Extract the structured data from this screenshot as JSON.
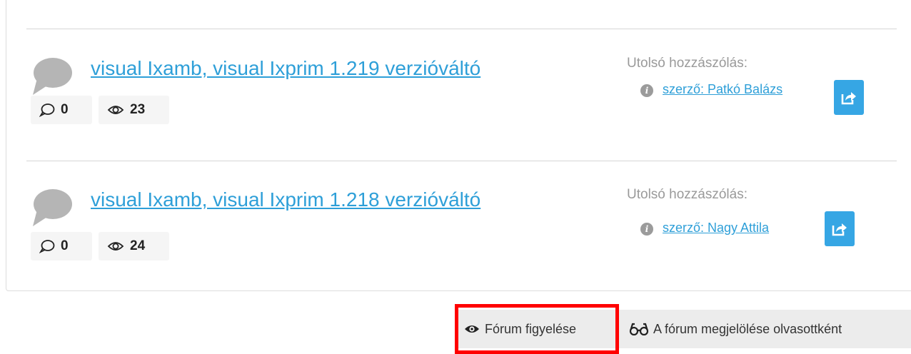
{
  "topics": [
    {
      "title": "visual Ixamb, visual Ixprim 1.219 verzióváltó",
      "replies": "0",
      "views": "23",
      "last_post_label": "Utolsó hozzászólás:",
      "author": "szerző: Patkó Balázs"
    },
    {
      "title": "visual Ixamb, visual Ixprim 1.218 verzióváltó",
      "replies": "0",
      "views": "24",
      "last_post_label": "Utolsó hozzászólás:",
      "author": "szerző: Nagy Attila"
    }
  ],
  "footer": {
    "watch_label": "Fórum figyelése",
    "mark_read_label": "A fórum megjelölése olvasottként"
  },
  "icons": {
    "topic": "speech-bubble-icon",
    "replies": "comment-icon",
    "views": "eye-icon",
    "info": "info-icon",
    "go": "share-arrow-icon",
    "watch": "eye-icon",
    "mark_read": "glasses-icon"
  },
  "colors": {
    "link": "#2e9fd8",
    "button": "#36a6e4",
    "highlight": "#ff0000"
  }
}
